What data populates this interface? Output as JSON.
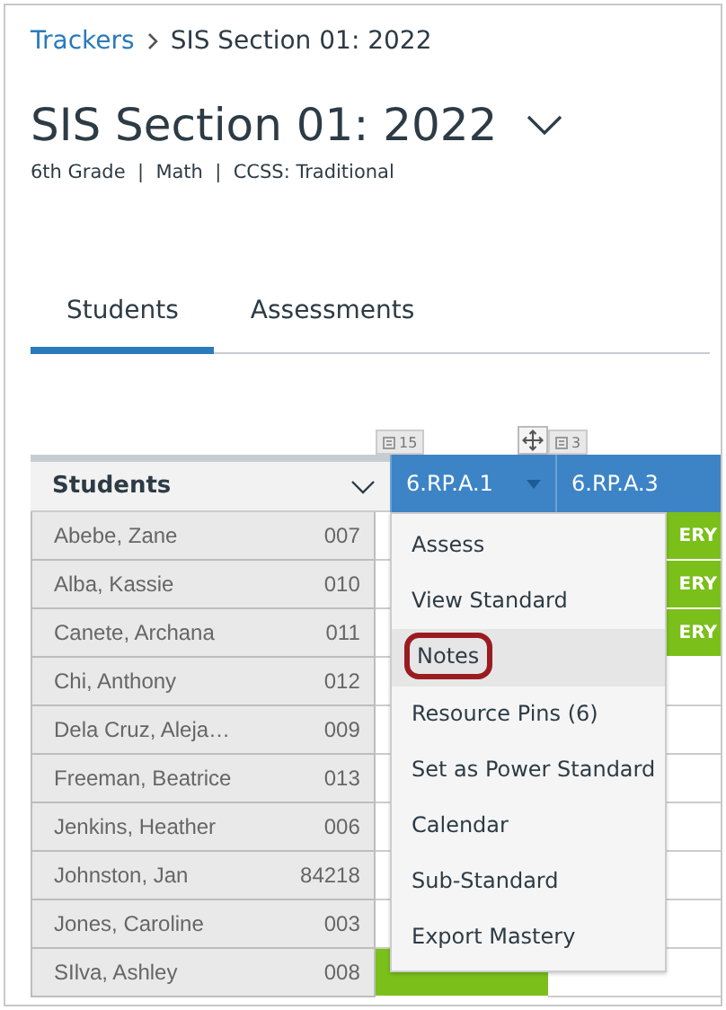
{
  "breadcrumb": {
    "link": "Trackers",
    "current": "SIS Section 01: 2022"
  },
  "title": "SIS Section 01: 2022",
  "subtitle": "6th Grade  |  Math  |  CCSS: Traditional",
  "tabs": [
    {
      "label": "Students",
      "selected": true
    },
    {
      "label": "Assessments",
      "selected": false
    }
  ],
  "table": {
    "student_header": "Students",
    "standards": [
      {
        "label": "6.RP.A.1",
        "count": "15",
        "movable": true
      },
      {
        "label": "6.RP.A.3",
        "count": "3",
        "movable": false
      }
    ],
    "rows": [
      {
        "name": "Abebe, Zane",
        "id": "007",
        "cells": [
          null,
          {
            "mastered": true,
            "text": "ERY"
          }
        ]
      },
      {
        "name": "Alba, Kassie",
        "id": "010",
        "cells": [
          null,
          {
            "mastered": true,
            "text": "ERY"
          }
        ]
      },
      {
        "name": "Canete, Archana",
        "id": "011",
        "cells": [
          null,
          {
            "mastered": true,
            "text": "ERY"
          }
        ]
      },
      {
        "name": "Chi, Anthony",
        "id": "012",
        "cells": [
          null,
          {
            "mastered": false
          }
        ]
      },
      {
        "name": "Dela Cruz, Aleja…",
        "id": "009",
        "cells": [
          null,
          {
            "mastered": false
          }
        ]
      },
      {
        "name": "Freeman, Beatrice",
        "id": "013",
        "cells": [
          null,
          {
            "mastered": false
          }
        ]
      },
      {
        "name": "Jenkins, Heather",
        "id": "006",
        "cells": [
          null,
          {
            "mastered": false
          }
        ]
      },
      {
        "name": "Johnston, Jan",
        "id": "84218",
        "cells": [
          null,
          {
            "mastered": false
          }
        ]
      },
      {
        "name": "Jones, Caroline",
        "id": "003",
        "cells": [
          null,
          {
            "mastered": false
          }
        ]
      },
      {
        "name": "SIlva, Ashley",
        "id": "008",
        "cells": [
          {
            "mastered": true
          },
          {
            "mastered": false
          }
        ]
      }
    ]
  },
  "menu": [
    {
      "label": "Assess",
      "selected": false
    },
    {
      "label": "View Standard",
      "selected": false
    },
    {
      "label": "Notes",
      "selected": true
    },
    {
      "label": "Resource Pins (6)",
      "selected": false
    },
    {
      "label": "Set as Power Standard",
      "selected": false
    },
    {
      "label": "Calendar",
      "selected": false
    },
    {
      "label": "Sub-Standard",
      "selected": false
    },
    {
      "label": "Export Mastery",
      "selected": false
    }
  ]
}
